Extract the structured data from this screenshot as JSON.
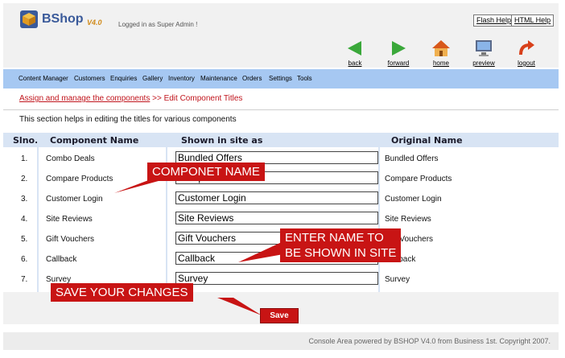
{
  "header": {
    "app_name": "BShop",
    "version": "V4.0",
    "logged_in_text": "Logged in as Super Admin !",
    "help_links": [
      "Flash Help",
      "HTML Help"
    ],
    "tools": [
      {
        "label": "back",
        "icon": "green-left-arrow-icon"
      },
      {
        "label": "forward",
        "icon": "green-right-arrow-icon"
      },
      {
        "label": "home",
        "icon": "home-icon"
      },
      {
        "label": "preview",
        "icon": "monitor-icon"
      },
      {
        "label": "logout",
        "icon": "red-curved-arrow-icon"
      }
    ]
  },
  "nav": {
    "items": [
      "Content Manager",
      "Customers",
      "Enquiries",
      "Gallery",
      "Inventory",
      "Maintenance",
      "Orders",
      "Settings",
      "Tools"
    ]
  },
  "breadcrumb": {
    "link": "Assign and manage the components",
    "current": " >> Edit Component Titles"
  },
  "description": "This section helps in editing the titles for various components",
  "table": {
    "headers": [
      "Slno.",
      "Component Name",
      "Shown in site as",
      "Original Name"
    ],
    "rows": [
      {
        "num": "1.",
        "component": "Combo Deals",
        "shown": "Bundled Offers",
        "original": "Bundled Offers"
      },
      {
        "num": "2.",
        "component": "Compare Products",
        "shown": "Compare Products",
        "original": "Compare Products"
      },
      {
        "num": "3.",
        "component": "Customer Login",
        "shown": "Customer Login",
        "original": "Customer Login"
      },
      {
        "num": "4.",
        "component": "Site Reviews",
        "shown": "Site Reviews",
        "original": "Site Reviews"
      },
      {
        "num": "5.",
        "component": "Gift Vouchers",
        "shown": "Gift Vouchers",
        "original": "Gift Vouchers"
      },
      {
        "num": "6.",
        "component": "Callback",
        "shown": "Callback",
        "original": "Callback"
      },
      {
        "num": "7.",
        "component": "Survey",
        "shown": "Survey",
        "original": "Survey"
      }
    ]
  },
  "save_label": "Save",
  "footer": "Console Area powered by BSHOP V4.0 from Business 1st. Copyright 2007.",
  "callouts": {
    "component_name": "COMPONET NAME",
    "enter_name_line1": "ENTER NAME TO",
    "enter_name_line2": "BE SHOWN IN SITE",
    "save_changes": "SAVE YOUR CHANGES"
  },
  "colors": {
    "nav_bar": "#a6c8f2",
    "table_header": "#d8e4f4",
    "callout_red": "#c81414",
    "breadcrumb_red": "#c0141c"
  }
}
